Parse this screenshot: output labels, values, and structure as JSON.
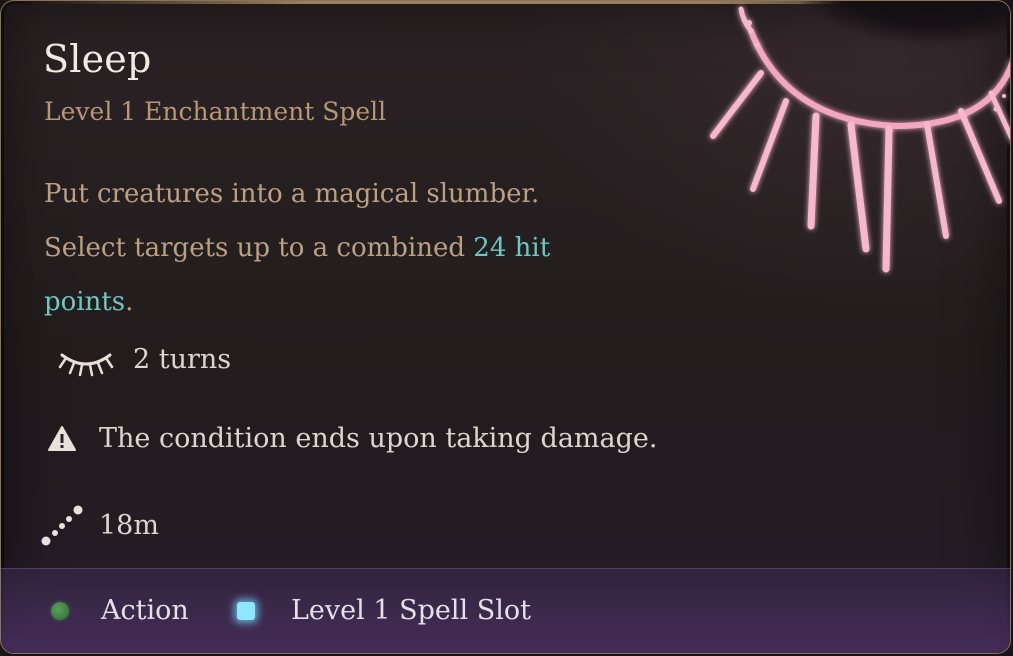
{
  "spell": {
    "name": "Sleep",
    "subtitle": "Level 1 Enchantment Spell",
    "description": {
      "line1": "Put creatures into a magical slumber.",
      "part2": "Select targets up to a combined ",
      "highlight_a": "24 hit",
      "highlight_b": "points",
      "end": "."
    },
    "duration": {
      "icon": "closed-eye-icon",
      "text": "2 turns"
    },
    "condition_note": {
      "icon": "warning-icon",
      "text": "The condition ends upon taking damage."
    },
    "range": {
      "icon": "range-icon",
      "text": "18m"
    }
  },
  "costs": [
    {
      "icon": "action-dot-icon",
      "label": "Action",
      "color": "#4f9a52"
    },
    {
      "icon": "spell-slot-icon",
      "label": "Level 1 Spell Slot",
      "color": "#8fe6ff"
    }
  ],
  "colors": {
    "title": "#f1ebe3",
    "subtitle": "#b79775",
    "description": "#bca084",
    "highlight": "#6fc7c4",
    "border": "#8a7358",
    "footer": "#4a3060"
  }
}
